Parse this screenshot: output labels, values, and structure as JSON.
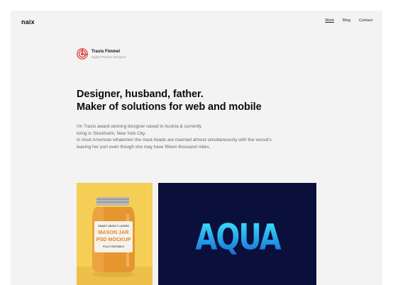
{
  "header": {
    "logo": "naix",
    "nav": [
      {
        "label": "Work",
        "active": true
      },
      {
        "label": "Blog",
        "active": false
      },
      {
        "label": "Contact",
        "active": false
      }
    ]
  },
  "author": {
    "name": "Travis Fimmel",
    "role": "Digital Product Designer",
    "logo_color": "#e23a3a"
  },
  "headline": {
    "line1": "Designer, husband, father.",
    "line2": "Maker of solutions for web and mobile"
  },
  "bio": {
    "line1": "I'm Travis award-winning designer raised in Austria & currently",
    "line2": "living in Stockholm, New York City.",
    "line3": "In most American whalemen the mast-heads are manned almost simultaneously with the vessel's",
    "line4": "leaving her port even though she may have fifteen thousand miles."
  },
  "portfolio": {
    "jar": {
      "label_top": "SMART OBJECT LAYERS",
      "title1": "MASON JAR",
      "title2": "PSD MOCKUP",
      "label_bottom": "FULLY EDITABLE",
      "bg_color": "#f4ce55"
    },
    "aqua": {
      "text": "AQUA",
      "bg_color": "#0b0f3b"
    }
  }
}
